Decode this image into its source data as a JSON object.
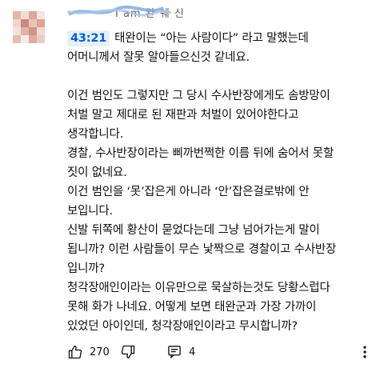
{
  "comment": {
    "author_obscured": "I am 완 쉐 신",
    "timestamp_link": "43:21",
    "lines": [
      "태완이는 “아는 사람이다” 라고 말했는데",
      "어머니께서 잘못 알아들으신것 같네요.",
      "",
      "이건 범인도 그렇지만 그 당시 수사반장에게도 솜방망이",
      "처벌 말고 제대로 된 재판과 처벌이 있어야한다고",
      "생각합니다.",
      "경찰, 수사반장이라는 삐까번쩍한 이름 뒤에 숨어서 못할",
      "짓이 없네요.",
      "이건 범인을 ‘못’잡은게 아니라 ‘안’잡은걸로밖에 안",
      "보입니다.",
      "신발 뒤쪽에 황산이 묻었다는데 그냥 넘어가는게 말이",
      "됩니까? 이런 사람들이 무슨 낯짝으로 경찰이고 수사반장",
      "입니까?",
      "청각장애인이라는 이유만으로 묵살하는것도 당황스럽다",
      "못해 화가 나네요. 어떻게 보면 태완군과 가장 가까이",
      "있었던 아이인데, 청각장애인이라고 무시합니까?"
    ]
  },
  "actions": {
    "like_count": "270",
    "reply_count": "4",
    "icons": [
      "thumbs-up-icon",
      "thumbs-down-icon",
      "reply-icon",
      "more-vert-icon"
    ]
  },
  "colors": {
    "timestamp_bg": "#e6f0fb",
    "timestamp_text": "#065fd4",
    "text": "#0f0f0f"
  }
}
